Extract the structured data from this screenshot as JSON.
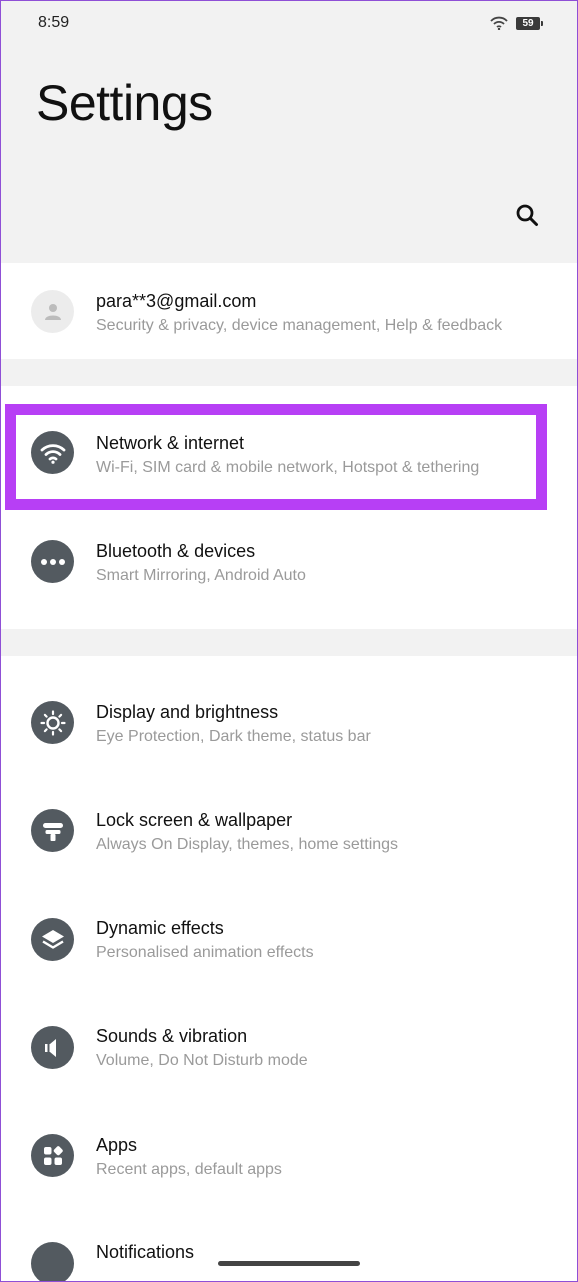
{
  "status_bar": {
    "time": "8:59",
    "battery": "59",
    "icons": [
      "wifi-icon",
      "battery-icon"
    ]
  },
  "header": {
    "title": "Settings",
    "search_icon": "search-icon"
  },
  "account": {
    "email": "para**3@gmail.com",
    "subtitle": "Security & privacy, device management, Help & feedback",
    "icon": "person-icon"
  },
  "items": [
    {
      "title": "Network & internet",
      "subtitle": "Wi-Fi, SIM card & mobile network, Hotspot & tethering",
      "icon": "wifi-icon",
      "highlighted": true
    },
    {
      "title": "Bluetooth & devices",
      "subtitle": "Smart Mirroring, Android Auto",
      "icon": "more-dots-icon"
    },
    {
      "title": "Display and brightness",
      "subtitle": "Eye Protection, Dark theme, status bar",
      "icon": "brightness-icon"
    },
    {
      "title": "Lock screen & wallpaper",
      "subtitle": "Always On Display, themes, home settings",
      "icon": "wallpaper-icon"
    },
    {
      "title": "Dynamic effects",
      "subtitle": "Personalised animation effects",
      "icon": "layers-icon"
    },
    {
      "title": "Sounds & vibration",
      "subtitle": "Volume, Do Not Disturb mode",
      "icon": "speaker-icon"
    },
    {
      "title": "Apps",
      "subtitle": "Recent apps, default apps",
      "icon": "apps-icon"
    },
    {
      "title": "Notifications",
      "subtitle": "",
      "icon": "bell-icon"
    }
  ],
  "colors": {
    "highlight": "#b73ff5",
    "icon_bg": "#535a60",
    "background": "#f2f2f2"
  }
}
